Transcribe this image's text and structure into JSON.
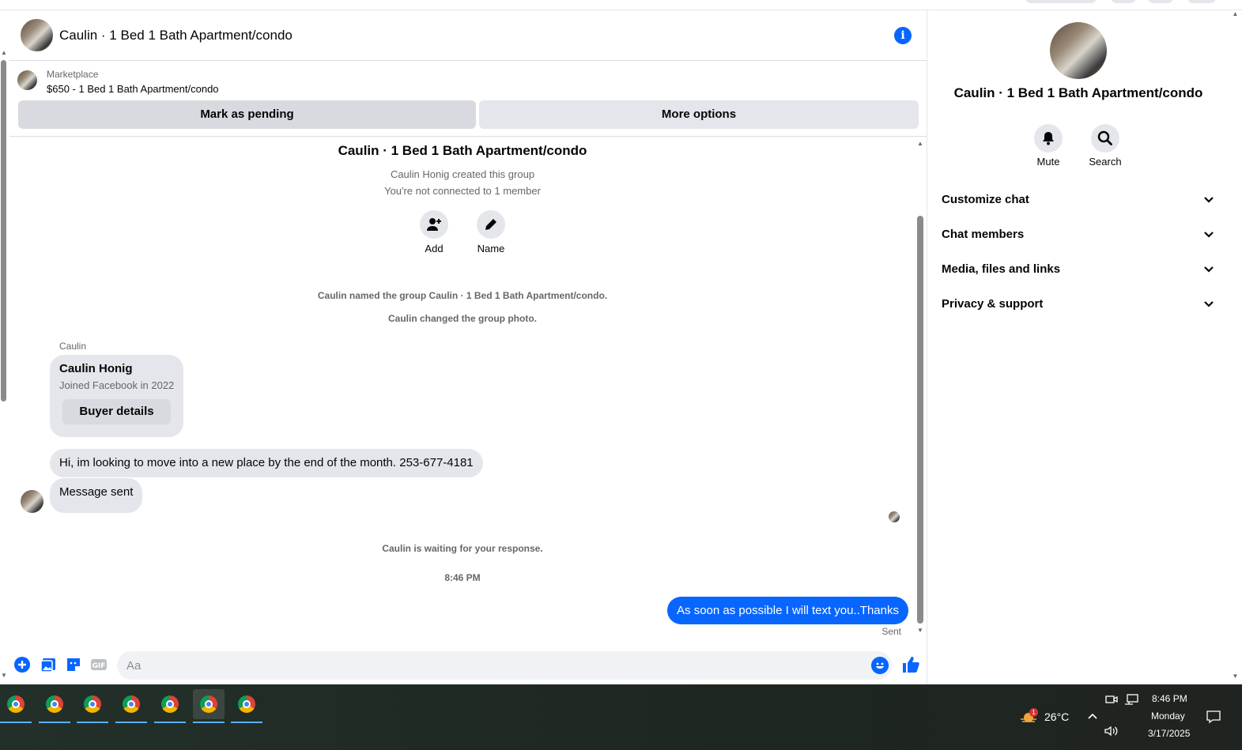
{
  "chat": {
    "title": "Caulin · 1 Bed 1 Bath Apartment/condo",
    "listing": {
      "source": "Marketplace",
      "price_title": "$650 - 1 Bed 1 Bath Apartment/condo",
      "pending_label": "Mark as pending",
      "more_label": "More options"
    },
    "thread": {
      "group_title": "Caulin · 1 Bed 1 Bath Apartment/condo",
      "created": "Caulin Honig created this group",
      "not_connected": "You're not connected to 1 member",
      "add_label": "Add",
      "name_label": "Name",
      "sys_named": "Caulin named the group Caulin · 1 Bed 1 Bath Apartment/condo.",
      "sys_photo": "Caulin changed the group photo.",
      "sender": "Caulin",
      "card_name": "Caulin Honig",
      "card_joined": "Joined Facebook in 2022",
      "card_button": "Buyer details",
      "msg1": "Hi, im looking to move into a new place by the end of the month. 253-677-4181",
      "msg2": "Message sent",
      "waiting": "Caulin is waiting for your response.",
      "time": "8:46 PM",
      "out_msg": "As soon as possible I will text you..Thanks",
      "sent": "Sent"
    },
    "composer": {
      "placeholder": "Aa"
    }
  },
  "side": {
    "title": "Caulin · 1 Bed 1 Bath Apartment/condo",
    "mute": "Mute",
    "search": "Search",
    "sections": [
      "Customize chat",
      "Chat members",
      "Media, files and links",
      "Privacy & support"
    ]
  },
  "taskbar": {
    "temperature": "26°C",
    "badge": "1",
    "clock_time": "8:46 PM",
    "clock_day": "Monday",
    "clock_date": "3/17/2025"
  },
  "colors": {
    "accent": "#0866ff",
    "bubble_gray": "#e4e6eb"
  }
}
